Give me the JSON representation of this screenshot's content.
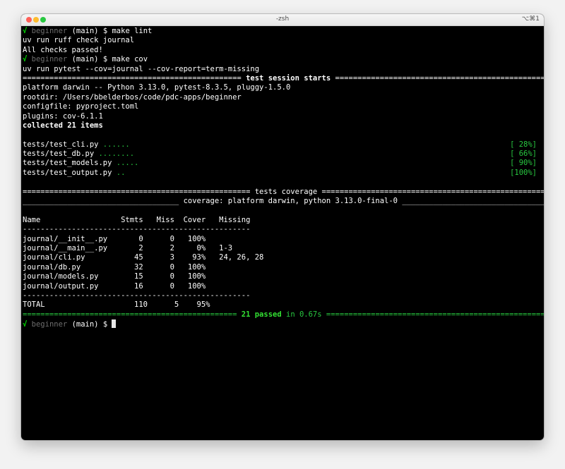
{
  "window": {
    "title": "-zsh",
    "shortcut": "⌥⌘1"
  },
  "prompt": {
    "check": "√",
    "dir": "beginner",
    "branch": "(main)",
    "symbol": "$"
  },
  "commands": {
    "lint": "make lint",
    "cov": "make cov"
  },
  "lint_output": [
    "uv run ruff check journal",
    "All checks passed!"
  ],
  "cov_command_echo": "uv run pytest --cov=journal --cov-report=term-missing",
  "session": {
    "sep_left": "=================================================",
    "title": "test session starts",
    "sep_right": "=====================================================",
    "platform": "platform darwin -- Python 3.13.0, pytest-8.3.5, pluggy-1.5.0",
    "rootdir": "rootdir: /Users/bbelderbos/code/pdc-apps/beginner",
    "configfile": "configfile: pyproject.toml",
    "plugins": "plugins: cov-6.1.1",
    "collected": "collected 21 items"
  },
  "test_results": [
    {
      "file": "tests/test_cli.py",
      "dots": "......",
      "pct": "[ 28%]"
    },
    {
      "file": "tests/test_db.py",
      "dots": "........",
      "pct": "[ 66%]"
    },
    {
      "file": "tests/test_models.py",
      "dots": ".....",
      "pct": "[ 90%]"
    },
    {
      "file": "tests/test_output.py",
      "dots": "..",
      "pct": "[100%]"
    }
  ],
  "coverage": {
    "header_line": "=================================================== tests coverage ====================================================",
    "sub_header_line": "___________________________________ coverage: platform darwin, python 3.13.0-final-0 ___________________________________",
    "column_header": "Name                  Stmts   Miss  Cover   Missing",
    "divider": "---------------------------------------------------",
    "rows": [
      "journal/__init__.py       0      0   100%",
      "journal/__main__.py       2      2     0%   1-3",
      "journal/cli.py           45      3    93%   24, 26, 28",
      "journal/db.py            32      0   100%",
      "journal/models.py        15      0   100%",
      "journal/output.py        16      0   100%"
    ],
    "total": "TOTAL                    110      5    95%"
  },
  "summary": {
    "sep_left": "================================================",
    "passed": "21 passed",
    "time": "in 0.67s",
    "sep_right": "=================================================="
  }
}
